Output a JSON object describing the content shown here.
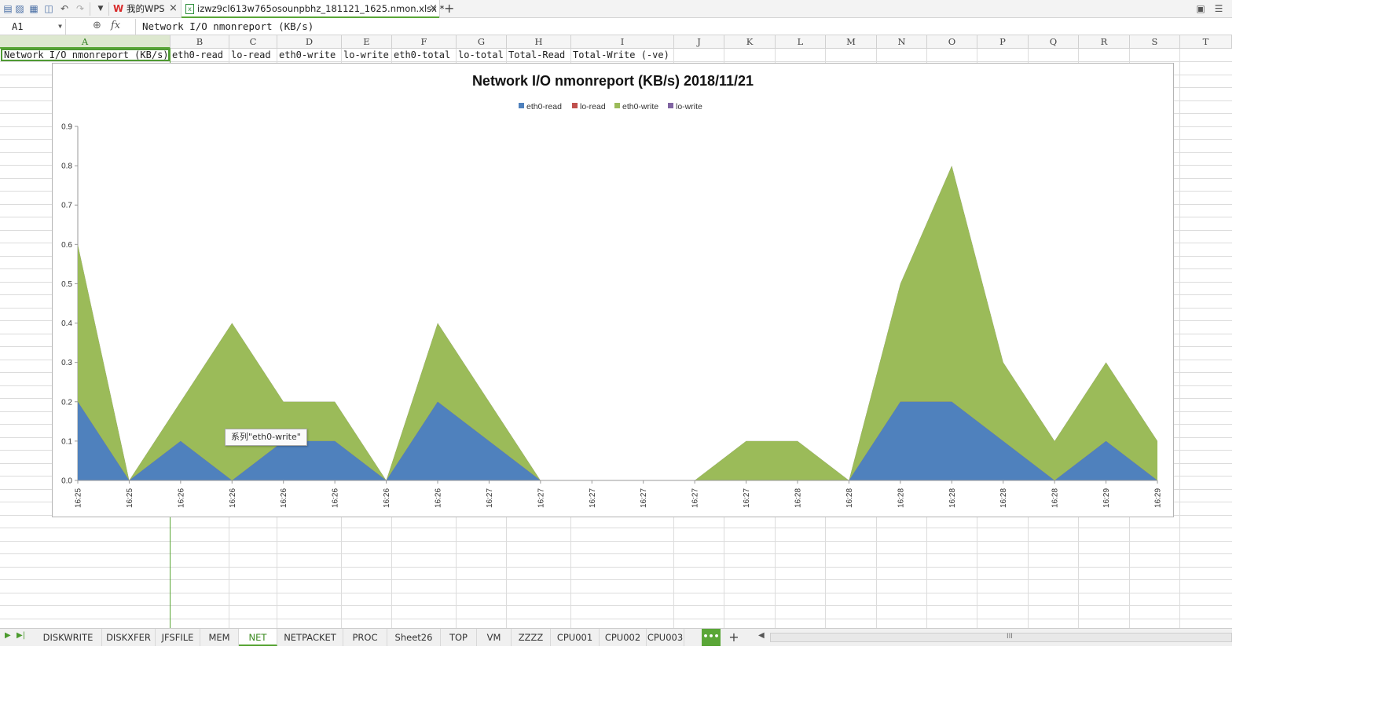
{
  "titlebar": {
    "tabs": [
      {
        "label": "我的WPS",
        "close": "×"
      },
      {
        "label": "izwz9cl613w765osounpbhz_181121_1625.nmon.xlsx *",
        "close": "×"
      }
    ],
    "new_tab": "+"
  },
  "formula_bar": {
    "name_box": "A1",
    "fx": "fx",
    "formula": "Network I/O nmonreport (KB/s)"
  },
  "columns": [
    "A",
    "B",
    "C",
    "D",
    "E",
    "F",
    "G",
    "H",
    "I",
    "J",
    "K",
    "L",
    "M",
    "N",
    "O",
    "P",
    "Q",
    "R",
    "S",
    "T"
  ],
  "row1": [
    "Network I/O nmonreport (KB/s)",
    "eth0-read",
    "lo-read",
    "eth0-write",
    "lo-write",
    "eth0-total",
    "lo-total",
    "Total-Read",
    "Total-Write (-ve)"
  ],
  "tooltip": "系列\"eth0-write\"",
  "colors": {
    "accent": "#5aa637",
    "eth0_read": "#4f81bd",
    "lo_read": "#c0504d",
    "eth0_write": "#9bbb59",
    "lo_write": "#8064a2"
  },
  "chart_data": {
    "type": "area",
    "stacked": true,
    "title": "Network I/O nmonreport (KB/s)  2018/11/21",
    "legend_position": "top",
    "ylim": [
      0,
      0.9
    ],
    "yticks": [
      "0.0",
      "0.1",
      "0.2",
      "0.3",
      "0.4",
      "0.5",
      "0.6",
      "0.7",
      "0.8",
      "0.9"
    ],
    "categories": [
      "16:25",
      "16:25",
      "16:26",
      "16:26",
      "16:26",
      "16:26",
      "16:26",
      "16:26",
      "16:27",
      "16:27",
      "16:27",
      "16:27",
      "16:27",
      "16:27",
      "16:28",
      "16:28",
      "16:28",
      "16:28",
      "16:28",
      "16:28",
      "16:29",
      "16:29"
    ],
    "series": [
      {
        "name": "eth0-read",
        "color": "#4f81bd",
        "values": [
          0.2,
          0,
          0.1,
          0,
          0.1,
          0.1,
          0,
          0.2,
          0.1,
          0,
          0,
          0,
          0,
          0,
          0,
          0,
          0.2,
          0.2,
          0.1,
          0,
          0.1,
          0
        ]
      },
      {
        "name": "lo-read",
        "color": "#c0504d",
        "values": [
          0,
          0,
          0,
          0,
          0,
          0,
          0,
          0,
          0,
          0,
          0,
          0,
          0,
          0,
          0,
          0,
          0,
          0,
          0,
          0,
          0,
          0
        ]
      },
      {
        "name": "eth0-write",
        "color": "#9bbb59",
        "values": [
          0.4,
          0,
          0.1,
          0.4,
          0.1,
          0.1,
          0,
          0.2,
          0.1,
          0,
          0,
          0,
          0,
          0.1,
          0.1,
          0,
          0.3,
          0.6,
          0.2,
          0.1,
          0.2,
          0.1
        ]
      },
      {
        "name": "lo-write",
        "color": "#8064a2",
        "values": [
          0,
          0,
          0,
          0,
          0,
          0,
          0,
          0,
          0,
          0,
          0,
          0,
          0,
          0,
          0,
          0,
          0,
          0,
          0,
          0,
          0,
          0
        ]
      }
    ]
  },
  "sheet_tabs": [
    "DISKWRITE",
    "DISKXFER",
    "JFSFILE",
    "MEM",
    "NET",
    "NETPACKET",
    "PROC",
    "Sheet26",
    "TOP",
    "VM",
    "ZZZZ",
    "CPU001",
    "CPU002",
    "CPU003"
  ],
  "active_sheet": "NET",
  "more_tabs": "•••",
  "add_sheet": "+",
  "hscroll_grip": "III"
}
